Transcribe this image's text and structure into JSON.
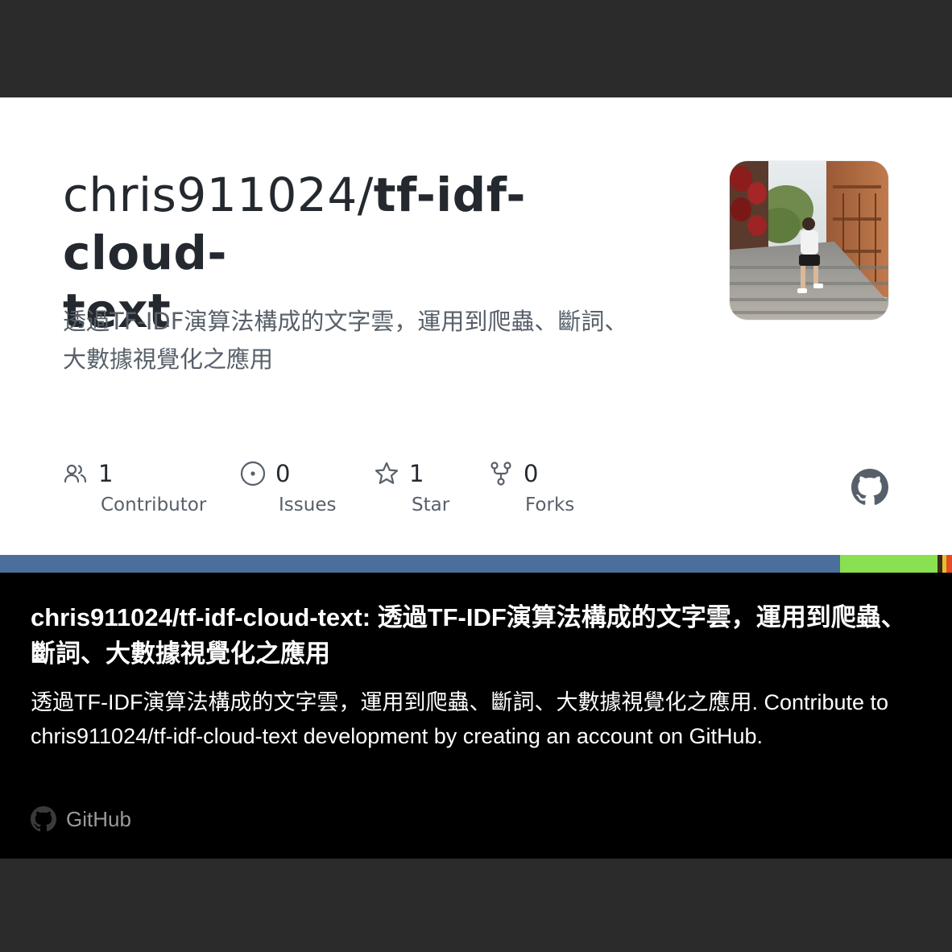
{
  "card": {
    "owner": "chris911024/",
    "repo_name_line1": "tf-idf-cloud-",
    "repo_name_line2": "text",
    "description": "透過TF-IDF演算法構成的文字雲，運用到爬蟲、斷詞、大數據視覺化之應用",
    "stats": [
      {
        "icon": "people-icon",
        "count": "1",
        "label": "Contributor"
      },
      {
        "icon": "issue-icon",
        "count": "0",
        "label": "Issues"
      },
      {
        "icon": "star-icon",
        "count": "1",
        "label": "Star"
      },
      {
        "icon": "fork-icon",
        "count": "0",
        "label": "Forks"
      }
    ],
    "language_bar": [
      {
        "color": "#4a6f9c",
        "share": 0.882
      },
      {
        "color": "#89e051",
        "share": 0.103
      },
      {
        "color": "#3a2a1a",
        "share": 0.005
      },
      {
        "color": "#e3c12a",
        "share": 0.004
      },
      {
        "color": "#e34c26",
        "share": 0.006
      }
    ]
  },
  "preview": {
    "title": "chris911024/tf-idf-cloud-text: 透過TF-IDF演算法構成的文字雲，運用到爬蟲、斷詞、大數據視覺化之應用",
    "description": "透過TF-IDF演算法構成的文字雲，運用到爬蟲、斷詞、大數據視覺化之應用. Contribute to chris911024/tf-idf-cloud-text development by creating an account on GitHub.",
    "site_name": "GitHub"
  },
  "colors": {
    "frame": "#2b2b2b",
    "title_text": "#24292f",
    "muted_text": "#57606a",
    "preview_bg": "#000000"
  }
}
